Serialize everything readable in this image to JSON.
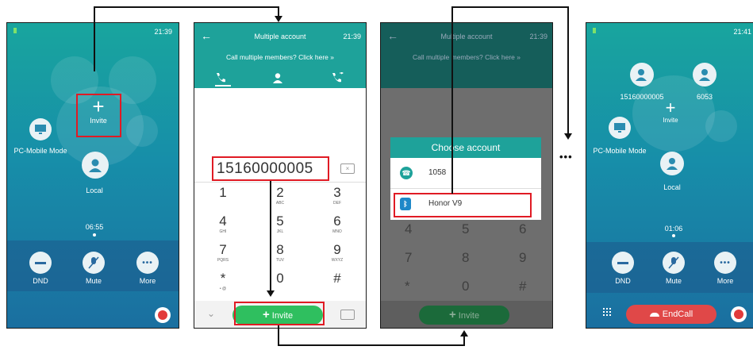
{
  "screen1": {
    "time": "21:39",
    "invite_label": "Invite",
    "pc_mobile_label": "PC-Mobile Mode",
    "local_label": "Local",
    "timer": "06:55",
    "dnd_label": "DND",
    "mute_label": "Mute",
    "more_label": "More"
  },
  "screen2": {
    "title": "Multiple account",
    "time": "21:39",
    "subtitle": "Call multiple members? Click here",
    "number": "15160000005",
    "keys": [
      {
        "d": "1",
        "s": ""
      },
      {
        "d": "2",
        "s": "ABC"
      },
      {
        "d": "3",
        "s": "DEF"
      },
      {
        "d": "4",
        "s": "GHI"
      },
      {
        "d": "5",
        "s": "JKL"
      },
      {
        "d": "6",
        "s": "MNO"
      },
      {
        "d": "7",
        "s": "PQRS"
      },
      {
        "d": "8",
        "s": "TUV"
      },
      {
        "d": "9",
        "s": "WXYZ"
      },
      {
        "d": "*",
        "s": "• @"
      },
      {
        "d": "0",
        "s": ""
      },
      {
        "d": "#",
        "s": ""
      }
    ],
    "invite_label": "Invite"
  },
  "screen3": {
    "title": "Multiple account",
    "time": "21:39",
    "subtitle": "Call multiple members? Click here",
    "dialog_title": "Choose account",
    "accounts": [
      "1058",
      "Honor V9"
    ],
    "invite_label": "Invite"
  },
  "ellipsis": "•••",
  "screen4": {
    "time": "21:41",
    "member1": "15160000005",
    "member2": "6053",
    "invite_label": "Invite",
    "pc_mobile_label": "PC-Mobile Mode",
    "local_label": "Local",
    "timer": "01:06",
    "dnd_label": "DND",
    "mute_label": "Mute",
    "more_label": "More",
    "endcall_label": "EndCall"
  },
  "colors": {
    "accent": "#1ea29a",
    "highlight": "#e01b24",
    "invite_green": "#2fbf5f",
    "endcall": "#e04848"
  }
}
